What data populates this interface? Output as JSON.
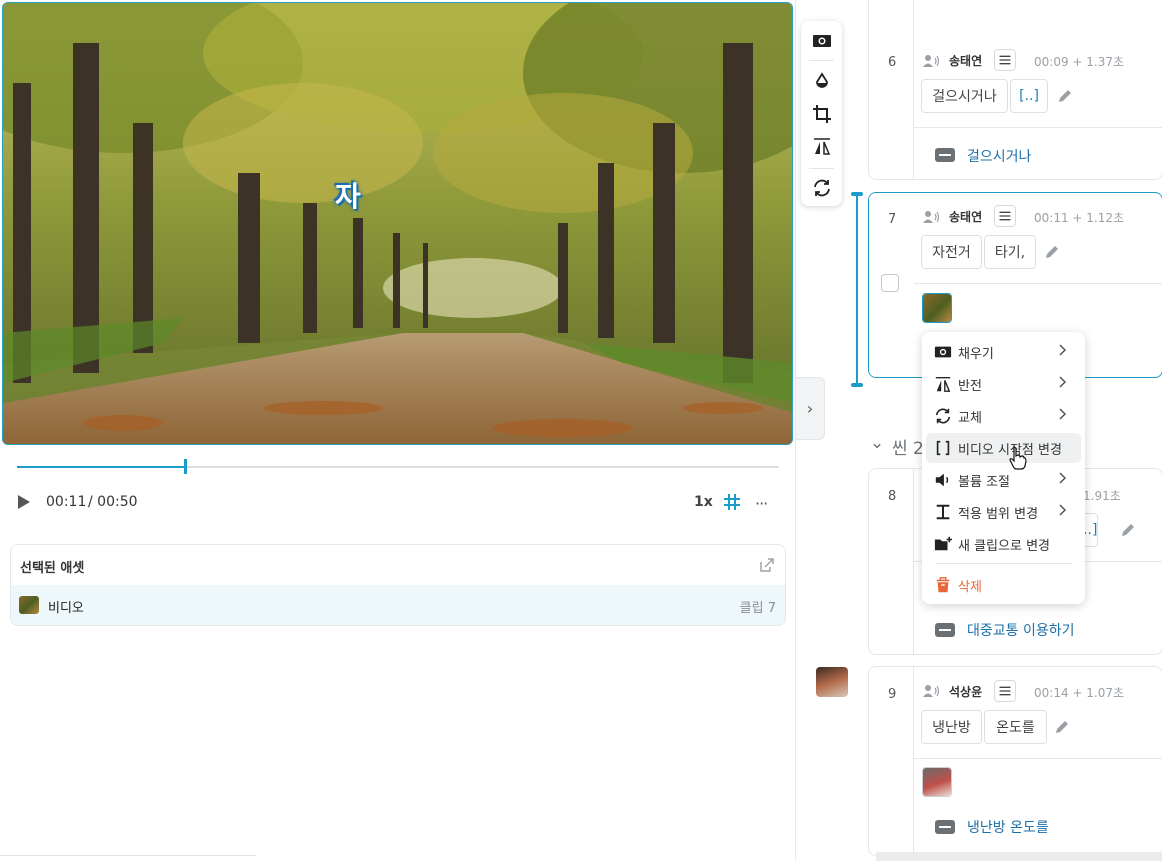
{
  "video": {
    "sticker_char": "자",
    "current_time": "00:11",
    "total_time": "/ 00:50",
    "speed": "1x",
    "progress": 0.221,
    "more_label": "···"
  },
  "assets_panel": {
    "title": "선택된 애셋",
    "item_name": "비디오",
    "item_clip": "클립 7"
  },
  "toolbar": {
    "icons": [
      "fill-icon",
      "color-drop-icon",
      "crop-icon",
      "flip-icon",
      "replace-icon"
    ]
  },
  "collapse_label": "›",
  "clips": [
    {
      "number": "6",
      "speaker": "송태연",
      "timing": "00:09 + 1.37초",
      "words": [
        "걸으시거나",
        "[..]"
      ],
      "subtitle": "걸으시거나"
    },
    {
      "number": "7",
      "speaker": "송태연",
      "timing": "00:11 + 1.12초",
      "words": [
        "자전거",
        "타기,"
      ]
    },
    {
      "number": "8",
      "timing_fragment": "1.91초",
      "word_fragment": "[..]",
      "subtitle": "대중교통 이용하기"
    },
    {
      "number": "9",
      "speaker": "석상윤",
      "timing": "00:14 + 1.07초",
      "words": [
        "냉난방",
        "온도를"
      ],
      "subtitle": "냉난방 온도를"
    }
  ],
  "scene_header": "씬 2",
  "context_menu": {
    "items": [
      {
        "label": "채우기",
        "icon": "fill-icon",
        "submenu": true
      },
      {
        "label": "반전",
        "icon": "flip-icon",
        "submenu": true
      },
      {
        "label": "교체",
        "icon": "replace-icon",
        "submenu": true
      },
      {
        "label": "비디오 시작점 변경",
        "icon": "bracket-icon",
        "submenu": false
      },
      {
        "label": "볼륨 조절",
        "icon": "volume-icon",
        "submenu": true
      },
      {
        "label": "적용 범위 변경",
        "icon": "range-icon",
        "submenu": true
      },
      {
        "label": "새 클립으로 변경",
        "icon": "new-clip-icon",
        "submenu": false
      },
      {
        "label": "삭제",
        "icon": "trash-icon",
        "submenu": false
      }
    ],
    "hovered_index": 3
  },
  "colors": {
    "accent": "#1c9cc8",
    "link": "#1c6fa8",
    "danger": "#e8673a"
  }
}
